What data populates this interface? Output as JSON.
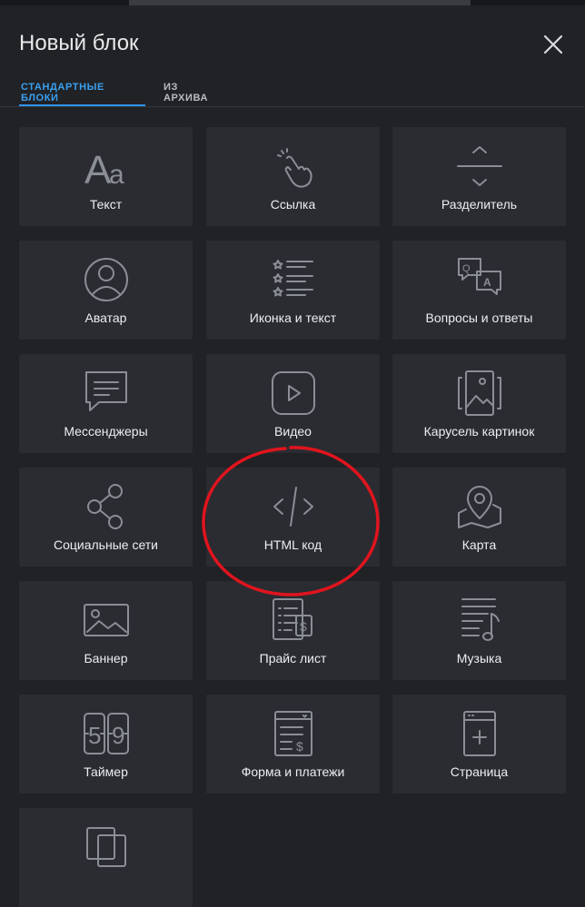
{
  "dialog": {
    "title": "Новый блок",
    "tabs": [
      {
        "label": "СТАНДАРТНЫЕ БЛОКИ",
        "active": true
      },
      {
        "label": "ИЗ АРХИВА",
        "active": false
      }
    ]
  },
  "blocks": [
    {
      "label": "Текст",
      "icon": "text-aa-icon"
    },
    {
      "label": "Ссылка",
      "icon": "hand-pointer-icon"
    },
    {
      "label": "Разделитель",
      "icon": "divider-icon"
    },
    {
      "label": "Аватар",
      "icon": "avatar-icon"
    },
    {
      "label": "Иконка и текст",
      "icon": "icon-list-icon"
    },
    {
      "label": "Вопросы и ответы",
      "icon": "qa-icon"
    },
    {
      "label": "Мессенджеры",
      "icon": "chat-icon"
    },
    {
      "label": "Видео",
      "icon": "video-play-icon"
    },
    {
      "label": "Карусель картинок",
      "icon": "image-carousel-icon"
    },
    {
      "label": "Социальные сети",
      "icon": "share-icon"
    },
    {
      "label": "HTML код",
      "icon": "code-icon"
    },
    {
      "label": "Карта",
      "icon": "map-pin-icon"
    },
    {
      "label": "Баннер",
      "icon": "banner-image-icon"
    },
    {
      "label": "Прайс лист",
      "icon": "price-list-icon"
    },
    {
      "label": "Музыка",
      "icon": "music-icon"
    },
    {
      "label": "Таймер",
      "icon": "timer-icon"
    },
    {
      "label": "Форма и платежи",
      "icon": "form-payment-icon"
    },
    {
      "label": "Страница",
      "icon": "page-add-icon"
    },
    {
      "label": "",
      "icon": "cards-icon"
    }
  ],
  "colors": {
    "background": "#202226",
    "tile": "#2a2c31",
    "accent": "#3a9ff0",
    "icon": "#8a8e96",
    "annotation": "#e0141e"
  }
}
